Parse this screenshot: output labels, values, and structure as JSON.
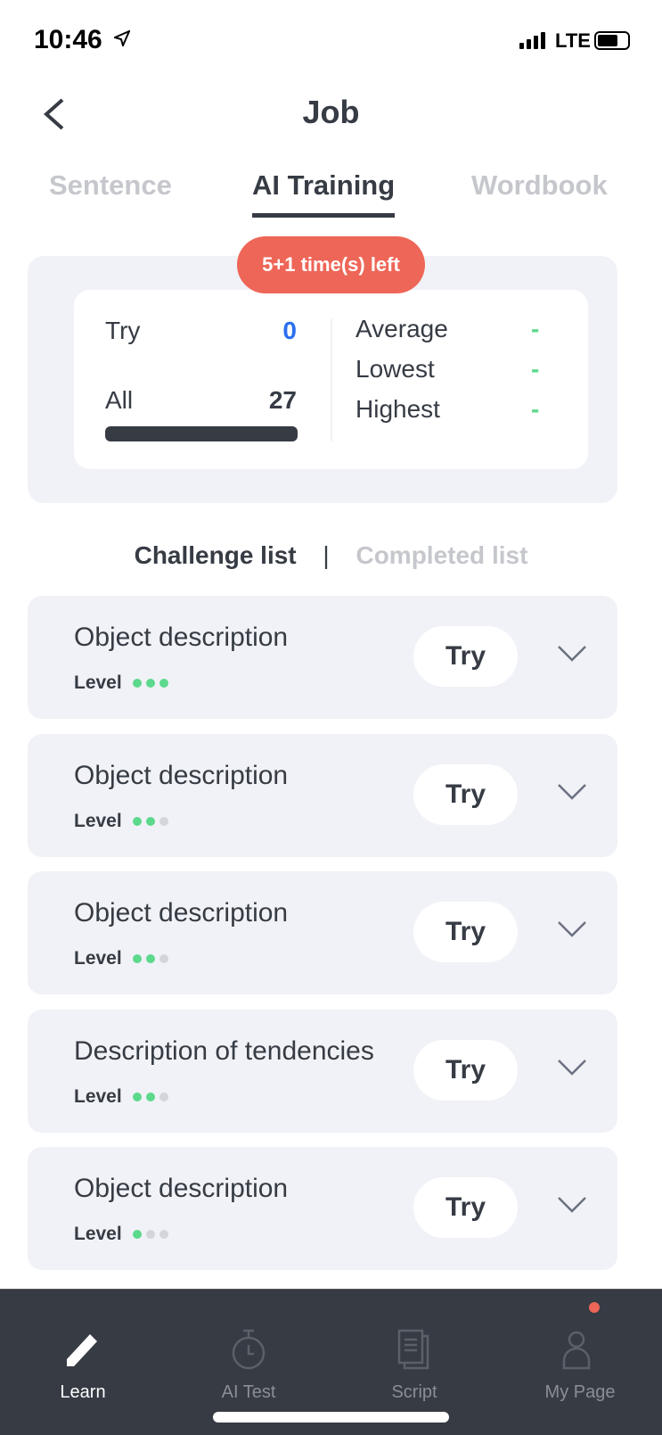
{
  "status_bar": {
    "time": "10:46",
    "network": "LTE"
  },
  "header": {
    "title": "Job"
  },
  "tabs": [
    {
      "label": "Sentence"
    },
    {
      "label": "AI Training",
      "active": true
    },
    {
      "label": "Wordbook"
    }
  ],
  "stats": {
    "badge": "5+1 time(s) left",
    "try_label": "Try",
    "try_value": "0",
    "all_label": "All",
    "all_value": "27",
    "all_progress_percent": 100,
    "average_label": "Average",
    "average_value": "-",
    "lowest_label": "Lowest",
    "lowest_value": "-",
    "highest_label": "Highest",
    "highest_value": "-"
  },
  "sublist": {
    "challenge": "Challenge list",
    "separator": "|",
    "completed": "Completed list"
  },
  "items": [
    {
      "name": "Object description",
      "level_label": "Level",
      "level": 3,
      "button": "Try"
    },
    {
      "name": "Object description",
      "level_label": "Level",
      "level": 2,
      "button": "Try"
    },
    {
      "name": "Object description",
      "level_label": "Level",
      "level": 2,
      "button": "Try"
    },
    {
      "name": "Description of tendencies",
      "level_label": "Level",
      "level": 2,
      "button": "Try"
    },
    {
      "name": "Object description",
      "level_label": "Level",
      "level": 1,
      "button": "Try"
    }
  ],
  "tabbar": [
    {
      "label": "Learn",
      "icon": "pencil-icon",
      "active": true
    },
    {
      "label": "AI Test",
      "icon": "stopwatch-icon"
    },
    {
      "label": "Script",
      "icon": "document-icon"
    },
    {
      "label": "My Page",
      "icon": "user-icon",
      "notification": true
    }
  ],
  "colors": {
    "accent": "#ee6657",
    "try_value": "#2b6ff0",
    "score": "#5cd98c",
    "dark": "#363b44"
  }
}
